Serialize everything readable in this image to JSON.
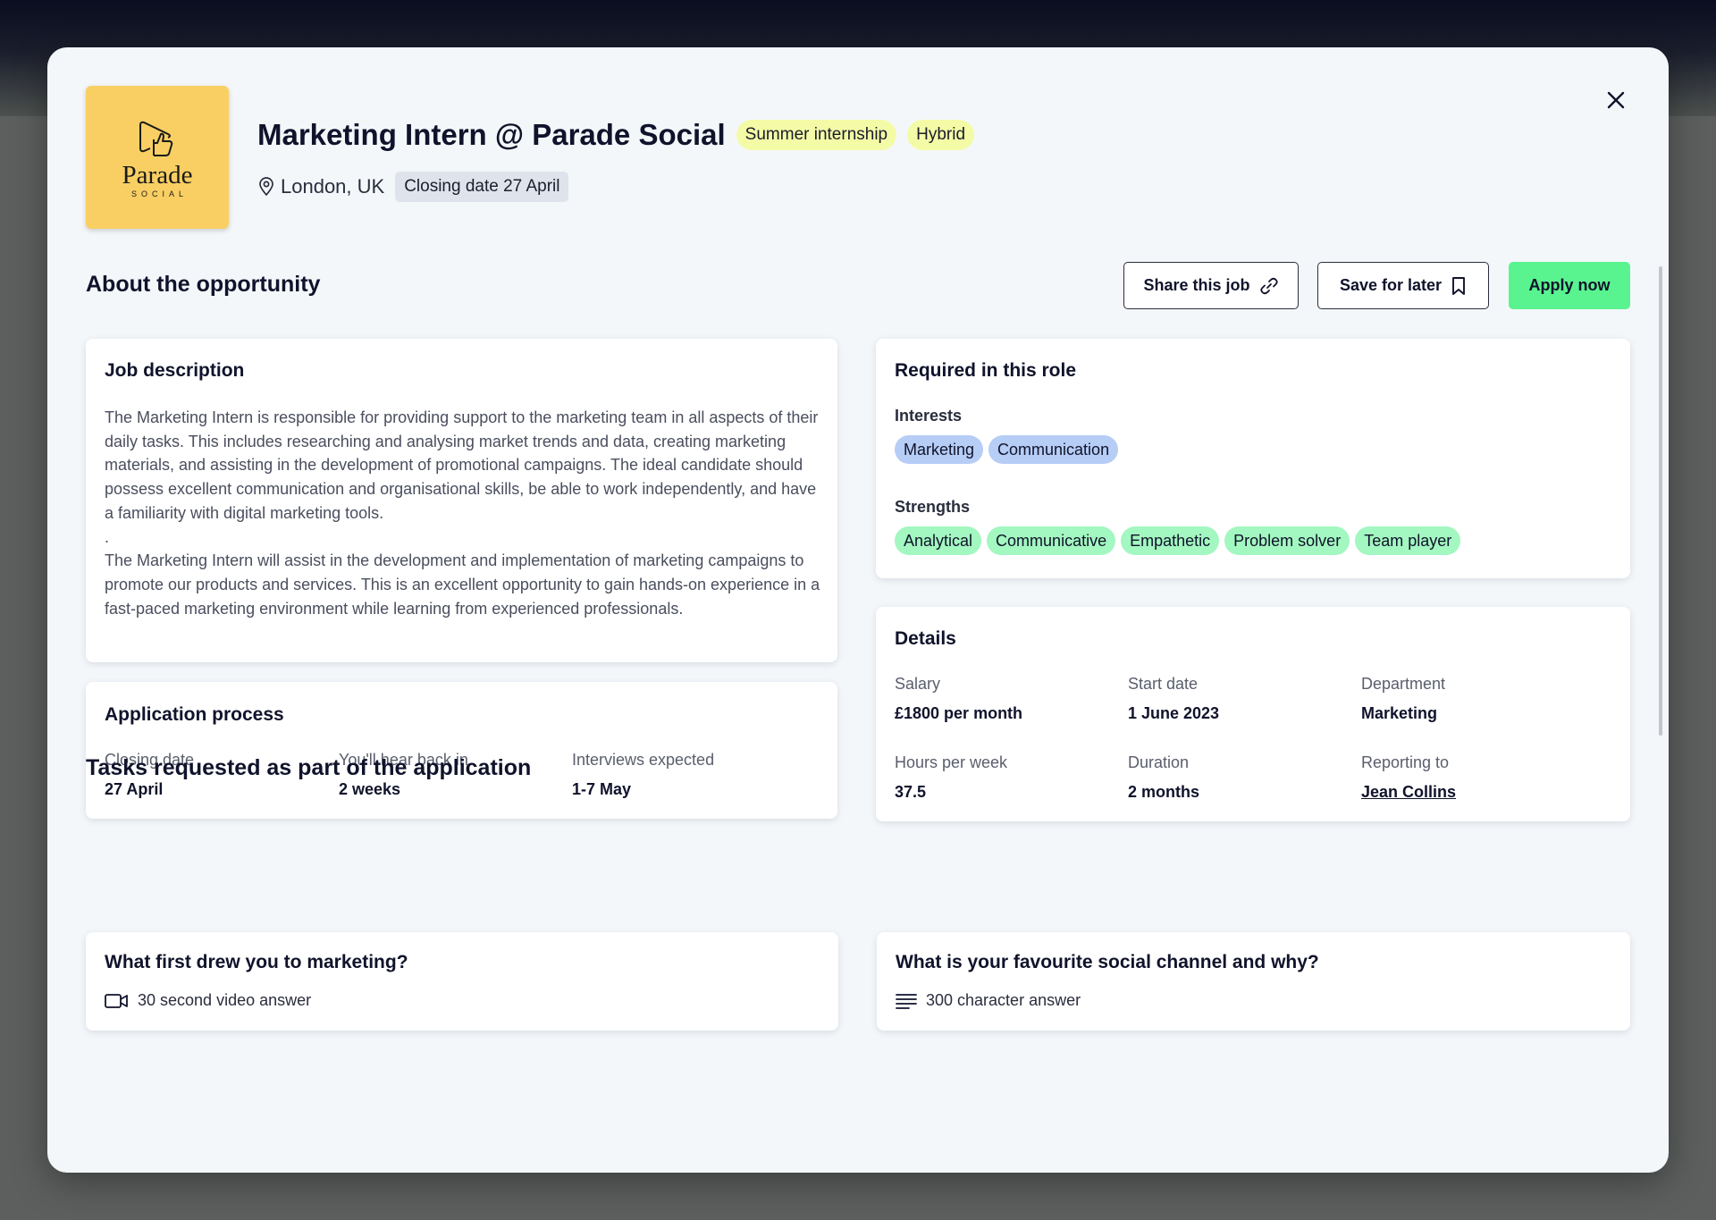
{
  "header": {
    "logo_name": "Parade",
    "logo_sub": "SOCIAL",
    "job_title": "Marketing Intern @ Parade Social",
    "tags": [
      "Summer internship",
      "Hybrid"
    ],
    "location": "London, UK",
    "closing_badge": "Closing date 27 April"
  },
  "about": {
    "title": "About the opportunity"
  },
  "actions": {
    "share_label": "Share this job",
    "save_label": "Save for later",
    "apply_label": "Apply now"
  },
  "job_description": {
    "title": "Job description",
    "para1": "The Marketing Intern is responsible for providing support to the marketing team in all aspects of their daily tasks. This includes researching and analysing market trends and data, creating marketing materials, and assisting in the development of promotional campaigns. The ideal candidate should possess excellent communication and organisational skills, be able to work independently, and have a familiarity with digital marketing tools.",
    "separator": ".",
    "para2": "The Marketing Intern will assist in the development and implementation of marketing campaigns to promote our products and services. This is an excellent opportunity to gain hands-on experience in a fast-paced marketing environment while learning from experienced professionals."
  },
  "required": {
    "title": "Required in this role",
    "interests_label": "Interests",
    "interests": [
      "Marketing",
      "Communication"
    ],
    "strengths_label": "Strengths",
    "strengths": [
      "Analytical",
      "Communicative",
      "Empathetic",
      "Problem solver",
      "Team player"
    ]
  },
  "application_process": {
    "title": "Application process",
    "fields": [
      {
        "label": "Closing date",
        "value": "27 April"
      },
      {
        "label": "You'll hear back in",
        "value": "2 weeks"
      },
      {
        "label": "Interviews expected",
        "value": "1-7 May"
      }
    ]
  },
  "details": {
    "title": "Details",
    "fields": [
      {
        "label": "Salary",
        "value": "£1800 per month"
      },
      {
        "label": "Start date",
        "value": "1 June 2023"
      },
      {
        "label": "Department",
        "value": "Marketing"
      },
      {
        "label": "Hours per week",
        "value": "37.5"
      },
      {
        "label": "Duration",
        "value": "2 months"
      },
      {
        "label": "Reporting to",
        "value": "Jean Collins"
      }
    ]
  },
  "tasks": {
    "title": "Tasks requested as part of the application",
    "items": [
      {
        "title": "What first drew you to marketing?",
        "meta": "30 second video answer",
        "icon": "video-icon"
      },
      {
        "title": "What is your favourite social channel and why?",
        "meta": "300 character answer",
        "icon": "text-lines-icon"
      }
    ]
  },
  "colors": {
    "apply_button": "#59f48f",
    "tag_yellow": "#f4fba6",
    "chip_blue": "#b6cdf6",
    "chip_green": "#a3f7c0",
    "logo_bg": "#f9cf63"
  }
}
